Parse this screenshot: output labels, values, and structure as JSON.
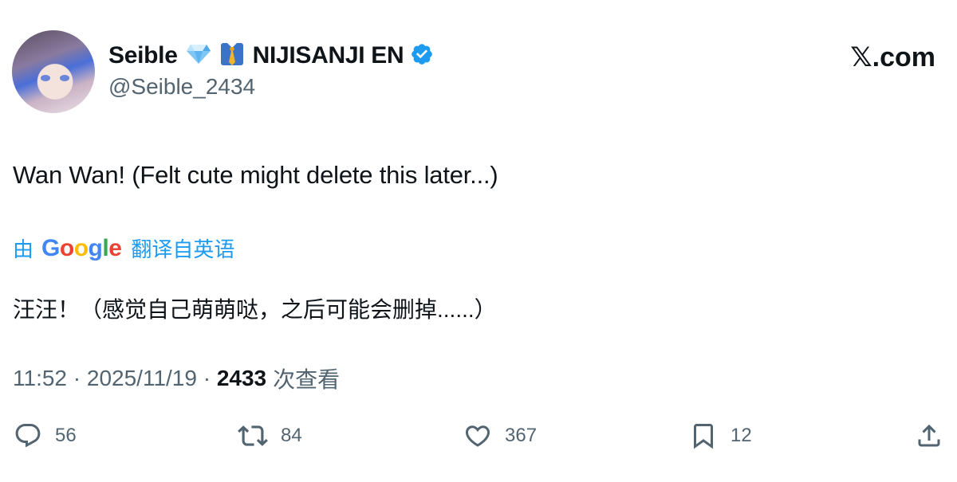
{
  "author": {
    "display_name": "Seible",
    "org_name": "NIJISANJI EN",
    "handle": "@Seible_2434"
  },
  "site_logo": "𝕏.com",
  "tweet": {
    "text": "Wan Wan! (Felt cute might delete this later...)",
    "translation_prefix": "由",
    "translation_provider": "Google",
    "translation_suffix": "翻译自英语",
    "translated_text": "汪汪！（感觉自己萌萌哒，之后可能会删掉......）"
  },
  "meta": {
    "time": "11:52",
    "separator": " · ",
    "date": "2025/11/19",
    "views": "2433",
    "views_label": "次查看"
  },
  "actions": {
    "replies": "56",
    "retweets": "84",
    "likes": "367",
    "bookmarks": "12"
  },
  "icons": {
    "badges": [
      "gem-icon",
      "necktie-icon",
      "verified-icon"
    ],
    "actions": [
      "reply-icon",
      "retweet-icon",
      "like-icon",
      "bookmark-icon",
      "share-icon"
    ]
  },
  "colors": {
    "accent": "#1d9bf0",
    "muted": "#536471",
    "text": "#0f1419"
  }
}
